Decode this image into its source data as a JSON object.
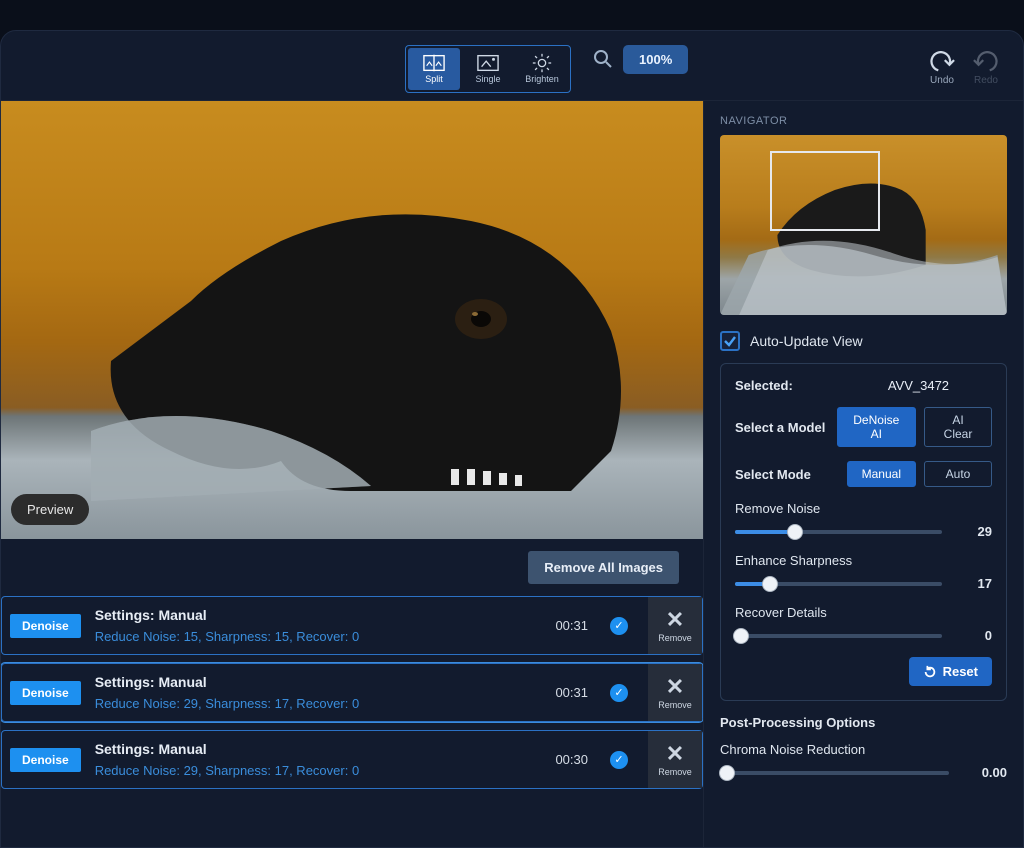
{
  "toolbar": {
    "split": "Split",
    "single": "Single",
    "brighten": "Brighten",
    "zoom": "100%",
    "undo": "Undo",
    "redo": "Redo"
  },
  "preview": {
    "chip": "Preview",
    "remove_all": "Remove All Images"
  },
  "queue": [
    {
      "badge": "Denoise",
      "title": "Settings: Manual",
      "sub": "Reduce Noise: 15, Sharpness: 15, Recover: 0",
      "time": "00:31",
      "remove": "Remove"
    },
    {
      "badge": "Denoise",
      "title": "Settings: Manual",
      "sub": "Reduce Noise: 29, Sharpness: 17, Recover: 0",
      "time": "00:31",
      "remove": "Remove"
    },
    {
      "badge": "Denoise",
      "title": "Settings: Manual",
      "sub": "Reduce Noise: 29, Sharpness: 17, Recover: 0",
      "time": "00:30",
      "remove": "Remove"
    }
  ],
  "navigator": {
    "label": "NAVIGATOR"
  },
  "auto_update": {
    "label": "Auto-Update View",
    "checked": true
  },
  "info": {
    "selected_label": "Selected:",
    "selected_value": "AVV_3472",
    "model_label": "Select a Model",
    "model_options": [
      "DeNoise AI",
      "AI Clear"
    ],
    "mode_label": "Select Mode",
    "mode_options": [
      "Manual",
      "Auto"
    ]
  },
  "sliders": {
    "remove_noise": {
      "label": "Remove Noise",
      "value": 29,
      "max": 100
    },
    "enhance_sharpness": {
      "label": "Enhance Sharpness",
      "value": 17,
      "max": 100
    },
    "recover_details": {
      "label": "Recover Details",
      "value": 0,
      "max": 100
    }
  },
  "reset": "Reset",
  "post": {
    "title": "Post-Processing Options",
    "chroma_label": "Chroma Noise Reduction",
    "chroma_value": "0.00"
  }
}
